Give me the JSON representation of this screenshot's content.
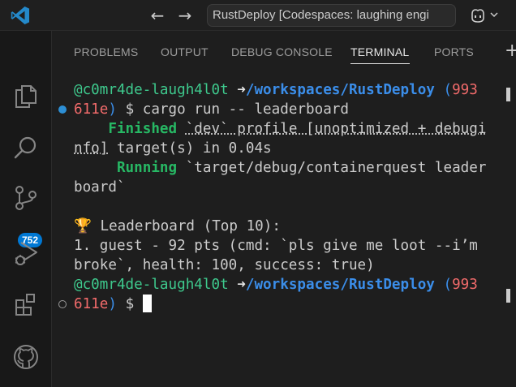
{
  "titlebar": {
    "logo_icon": "vscode-logo-icon",
    "back_icon": "arrow-left-icon",
    "forward_icon": "arrow-right-icon",
    "command_center": "RustDeploy [Codespaces: laughing engi",
    "copilot_icon": "copilot-icon",
    "accent": "#0078d4"
  },
  "activity_bar": {
    "items": [
      "explorer-icon",
      "search-icon",
      "source-control-icon",
      "run-debug-icon",
      "extensions-icon",
      "github-icon"
    ],
    "source_control_badge": "752"
  },
  "panel": {
    "tabs": [
      {
        "label": "PROBLEMS",
        "active": false
      },
      {
        "label": "OUTPUT",
        "active": false
      },
      {
        "label": "DEBUG CONSOLE",
        "active": false
      },
      {
        "label": "TERMINAL",
        "active": true
      },
      {
        "label": "PORTS",
        "active": false
      }
    ],
    "new_terminal_icon": "plus-icon"
  },
  "terminal": {
    "prompt_user": "@c0mr4de-laugh4l0t",
    "prompt_arrow": "➜",
    "prompt_path": "/workspaces/RustDeploy",
    "prompt_git_open": "(",
    "prompt_branch_a": "993",
    "prompt_branch_b": "611e",
    "prompt_git_close": ")",
    "prompt_symbol": "$",
    "command": "cargo run -- leaderboard",
    "finished_word": "Finished",
    "finished_rest_1": "`dev` profile [unoptimized + debugi",
    "finished_rest_2a": "nfo]",
    "finished_rest_2b": " target(s) in 0.04s",
    "running_word": "Running",
    "running_rest_1": "`target/debug/containerquest leader",
    "running_rest_2": "board`",
    "leaderboard_header": "🏆 Leaderboard (Top 10):",
    "leaderboard_line_1": "1. guest - 92 pts (cmd: `pls give me loot --i’m",
    "leaderboard_line_2": "broke`, health: 100, success: true)"
  }
}
